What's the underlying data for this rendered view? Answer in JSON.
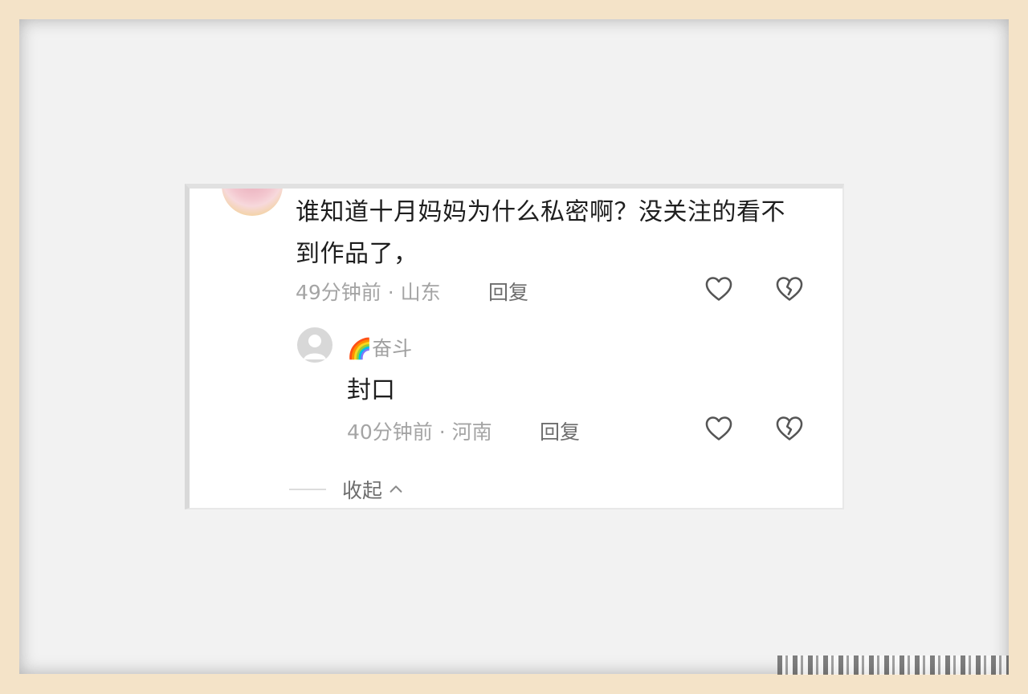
{
  "comment": {
    "text": "谁知道十月妈妈为什么私密啊？没关注的看不到作品了，",
    "meta": "49分钟前 · 山东",
    "reply_label": "回复"
  },
  "reply": {
    "username": "🌈奋斗",
    "text": "封口",
    "meta": "40分钟前 · 河南",
    "reply_label": "回复"
  },
  "collapse_label": "收起",
  "icons": {
    "like": "heart-outline-icon",
    "dislike": "broken-heart-icon",
    "collapse": "chevron-up-icon"
  },
  "colors": {
    "frame": "#f4e3c8",
    "mat": "#f2f2f2",
    "card": "#ffffff",
    "text_primary": "#1e1e1e",
    "text_meta": "#a4a4a4"
  }
}
